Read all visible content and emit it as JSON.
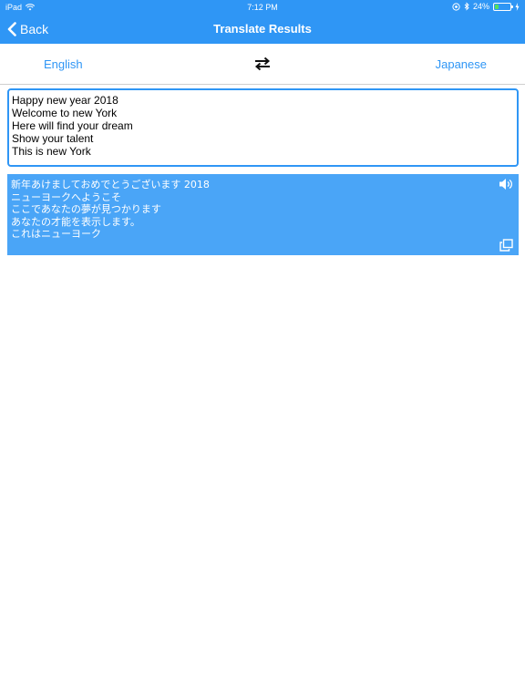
{
  "status_bar": {
    "device": "iPad",
    "time": "7:12 PM",
    "battery_percent": "24%",
    "battery_level": 0.24,
    "icons": [
      "wifi-icon",
      "location-icon",
      "bluetooth-icon",
      "battery-icon",
      "charging-icon"
    ]
  },
  "navbar": {
    "back_label": "Back",
    "title": "Translate Results",
    "background_color": "#2f96f5"
  },
  "languages": {
    "source": "English",
    "target": "Japanese",
    "swap_icon": "swap-arrows-icon",
    "accent_color": "#2f96f5"
  },
  "input": {
    "lines": [
      "Happy new year 2018",
      "Welcome to new York",
      "Here will find your dream",
      "Show your talent",
      "This is new York"
    ]
  },
  "output": {
    "lines": [
      "新年あけましておめでとうございます 2018",
      "ニューヨークへようこそ",
      "ここであなたの夢が見つかります",
      "あなたの才能を表示します。",
      "これはニューヨーク"
    ],
    "background_color": "#4aa5f7",
    "speak_icon": "speaker-icon",
    "copy_icon": "copy-icon"
  }
}
